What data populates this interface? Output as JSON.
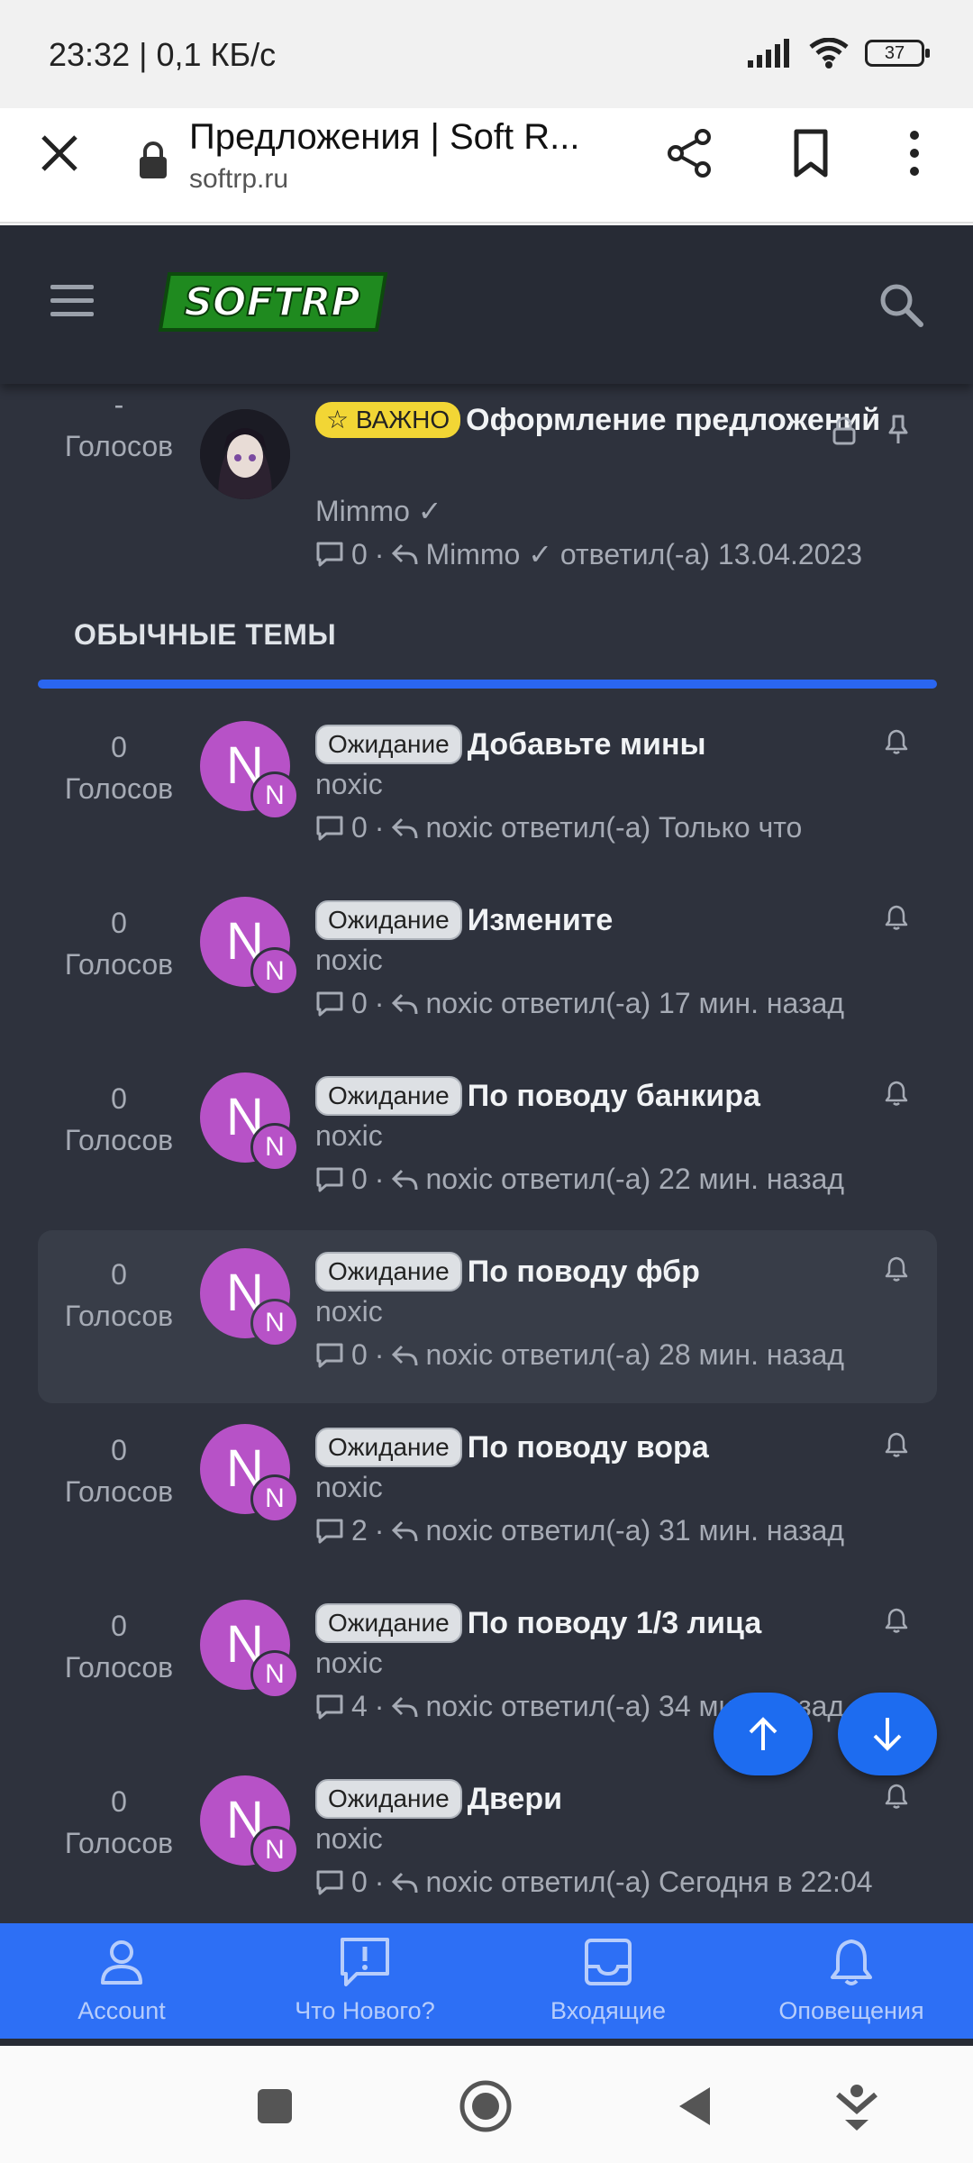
{
  "status_bar": {
    "time": "23:32 | 0,1 КБ/с",
    "battery": "37"
  },
  "browser": {
    "page_title": "Предложения | Soft R...",
    "url": "softrp.ru"
  },
  "site": {
    "logo_text": "SOFTRP",
    "important_thread": {
      "votes_top": "-",
      "votes_label": "Голосов",
      "badge": "☆ ВАЖНО",
      "title": "Оформление предложений",
      "author": "Mimmo ✓",
      "replies": "0",
      "last": "Mimmo ✓ ответил(-а) 13.04.2023"
    },
    "section_title": "ОБЫЧНЫЕ ТЕМЫ",
    "threads": [
      {
        "votes": "0",
        "votes_label": "Голосов",
        "avatar": "N",
        "prefix": "Ожидание",
        "title": "Добавьте мины",
        "author": "noxic",
        "replies": "0",
        "last": "noxic ответил(-а) Только что"
      },
      {
        "votes": "0",
        "votes_label": "Голосов",
        "avatar": "N",
        "prefix": "Ожидание",
        "title": "Измените",
        "author": "noxic",
        "replies": "0",
        "last": "noxic ответил(-а) 17 мин. назад"
      },
      {
        "votes": "0",
        "votes_label": "Голосов",
        "avatar": "N",
        "prefix": "Ожидание",
        "title": "По поводу банкира",
        "author": "noxic",
        "replies": "0",
        "last": "noxic ответил(-а) 22 мин. назад"
      },
      {
        "votes": "0",
        "votes_label": "Голосов",
        "avatar": "N",
        "prefix": "Ожидание",
        "title": "По поводу фбр",
        "author": "noxic",
        "replies": "0",
        "last": "noxic ответил(-а) 28 мин. назад"
      },
      {
        "votes": "0",
        "votes_label": "Голосов",
        "avatar": "N",
        "prefix": "Ожидание",
        "title": "По поводу вора",
        "author": "noxic",
        "replies": "2",
        "last": "noxic ответил(-а) 31 мин. назад"
      },
      {
        "votes": "0",
        "votes_label": "Голосов",
        "avatar": "N",
        "prefix": "Ожидание",
        "title": "По поводу 1/3 лица",
        "author": "noxic",
        "replies": "4",
        "last": "noxic ответил(-а) 34 мин. назад"
      },
      {
        "votes": "0",
        "votes_label": "Голосов",
        "avatar": "N",
        "prefix": "Ожидание",
        "title": "Двери",
        "author": "noxic",
        "replies": "0",
        "last": "noxic ответил(-а) Сегодня в 22:04"
      }
    ]
  },
  "bottom_nav": [
    {
      "label": "Account",
      "icon": "account-icon"
    },
    {
      "label": "Что Нового?",
      "icon": "whats-new-icon"
    },
    {
      "label": "Входящие",
      "icon": "inbox-icon"
    },
    {
      "label": "Оповещения",
      "icon": "bell-icon"
    }
  ],
  "colors": {
    "site_bg": "#2e323d",
    "header_bg": "#272b35",
    "accent": "#2d6ff5",
    "avatar": "#b752c7",
    "important_badge": "#f2d635"
  }
}
